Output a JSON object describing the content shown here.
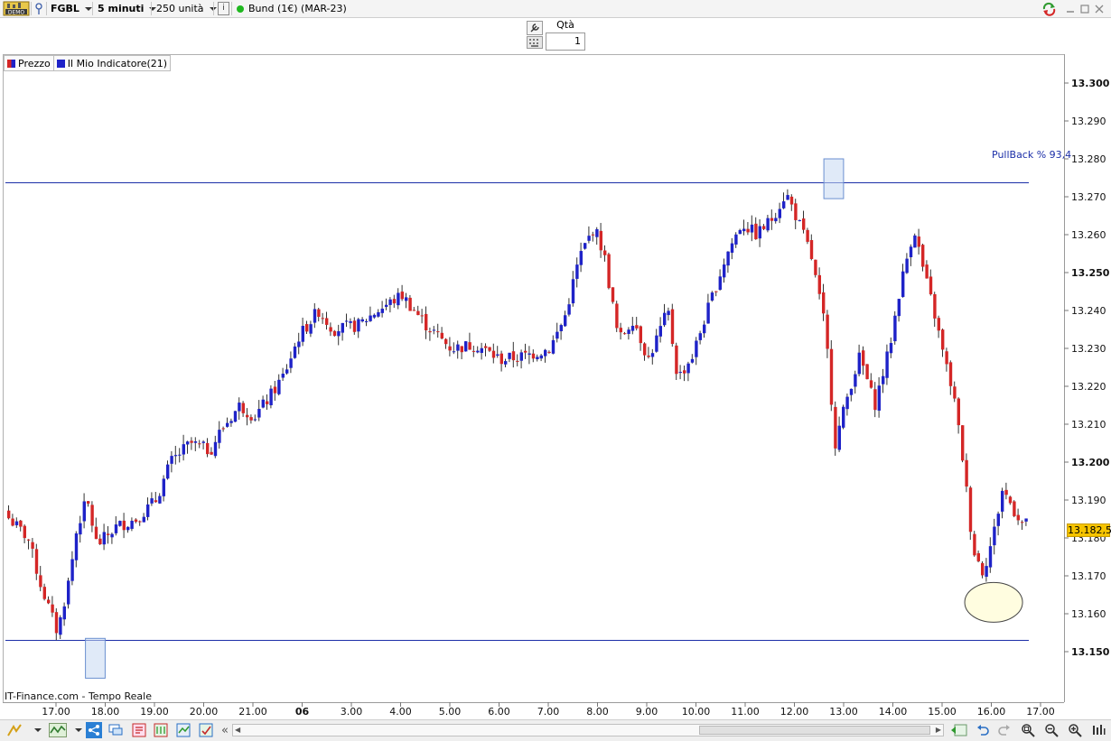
{
  "toolbar": {
    "demo_icon": "demo-badge-icon",
    "symbol": "FGBL",
    "timeframe": "5 minuti",
    "units": "250 unità",
    "info_label": "i",
    "instrument": "Bund (1€) (MAR-23)",
    "status_color": "#1fb81f"
  },
  "order": {
    "qta_label": "Qtà",
    "qta_value": "1"
  },
  "legend": [
    {
      "label": "Prezzo"
    },
    {
      "label": "Il Mio Indicatore(21)"
    }
  ],
  "footer": {
    "credit": "IT-Finance.com - Tempo Reale"
  },
  "chart_data": {
    "type": "candlestick",
    "colors": {
      "up": "#1e22c8",
      "down": "#d42626",
      "line": "#1c2fa8",
      "badge": "#f6c400"
    },
    "price_axis": {
      "ticks": [
        "13.300",
        "13.290",
        "13.280",
        "13.270",
        "13.260",
        "13.250",
        "13.240",
        "13.230",
        "13.220",
        "13.210",
        "13.200",
        "13.190",
        "13.180",
        "13.170",
        "13.160",
        "13.150"
      ],
      "bold_ticks": [
        "13.300",
        "13.250",
        "13.200",
        "13.150"
      ],
      "range": [
        13.145,
        13.305
      ]
    },
    "time_axis": {
      "labels": [
        "17.00",
        "18.00",
        "19.00",
        "20.00",
        "21.00",
        "06",
        "3.00",
        "4.00",
        "5.00",
        "6.00",
        "7.00",
        "8.00",
        "9.00",
        "10.00",
        "11.00",
        "12.00",
        "13.00",
        "14.00",
        "15.00",
        "16.00",
        "17.00"
      ],
      "bold_labels": [
        "06"
      ]
    },
    "last_price": "13.182,5",
    "annotation": "PullBack % 93,4",
    "horizontal_lines": [
      13.2737,
      13.153
    ],
    "highlight_boxes": [
      {
        "x_from": 0.8,
        "x_to": 1.2,
        "y_from": 13.143,
        "y_to": 13.1535
      },
      {
        "x_from": 15.8,
        "x_to": 16.2,
        "y_from": 13.2695,
        "y_to": 13.28
      }
    ],
    "highlight_ellipse": {
      "x": 18.9,
      "y": 13.163
    },
    "candles": []
  }
}
